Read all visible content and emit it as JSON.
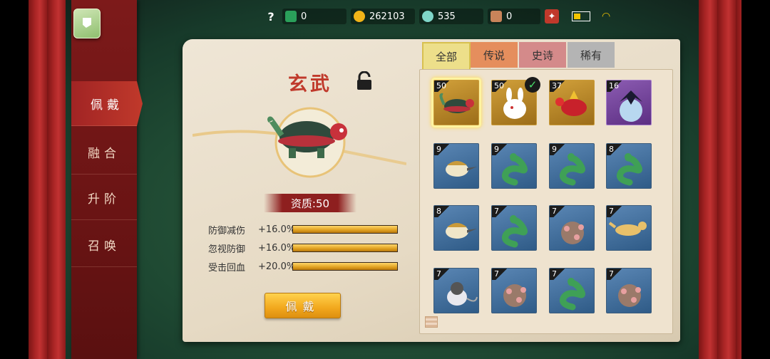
{
  "topbar": {
    "help": "?",
    "resources": [
      {
        "icon": "green-ticket-icon",
        "value": "0",
        "color": "#2aa05a"
      },
      {
        "icon": "gold-ingot-icon",
        "value": "262103",
        "color": "#f2b418"
      },
      {
        "icon": "jade-icon",
        "value": "535",
        "color": "#7fd6c8"
      },
      {
        "icon": "gate-token-icon",
        "value": "0",
        "color": "#c8845a"
      }
    ]
  },
  "sidebar": {
    "items": [
      {
        "label": "佩戴",
        "active": true
      },
      {
        "label": "融合",
        "active": false
      },
      {
        "label": "升阶",
        "active": false
      },
      {
        "label": "召唤",
        "active": false
      }
    ]
  },
  "detail": {
    "name": "玄武",
    "quality": "资质:50",
    "stats": [
      {
        "label": "防御减伤",
        "value": "+16.0%",
        "fill": 1.0
      },
      {
        "label": "忽视防御",
        "value": "+16.0%",
        "fill": 1.0
      },
      {
        "label": "受击回血",
        "value": "+20.0%",
        "fill": 1.0
      }
    ],
    "equip_label": "佩戴"
  },
  "tabs": [
    "全部",
    "传说",
    "史诗",
    "稀有"
  ],
  "pets": [
    {
      "level": "50",
      "rarity": "gold",
      "pet": "turtle-icon",
      "selected": true
    },
    {
      "level": "50",
      "rarity": "gold",
      "pet": "rabbit-icon",
      "equipped": true
    },
    {
      "level": "37",
      "rarity": "gold",
      "pet": "red-bird-icon"
    },
    {
      "level": "16",
      "rarity": "purple",
      "pet": "black-crow-icon"
    },
    {
      "level": "9",
      "rarity": "blue",
      "pet": "duckbill-icon"
    },
    {
      "level": "9",
      "rarity": "blue",
      "pet": "green-snake-icon"
    },
    {
      "level": "9",
      "rarity": "blue",
      "pet": "green-snake-icon"
    },
    {
      "level": "8",
      "rarity": "blue",
      "pet": "green-snake-icon"
    },
    {
      "level": "8",
      "rarity": "blue",
      "pet": "duckbill-icon"
    },
    {
      "level": "7",
      "rarity": "blue",
      "pet": "green-snake-icon"
    },
    {
      "level": "7",
      "rarity": "blue",
      "pet": "spotted-sheep-icon"
    },
    {
      "level": "7",
      "rarity": "blue",
      "pet": "otter-icon"
    },
    {
      "level": "7",
      "rarity": "blue",
      "pet": "mouse-icon"
    },
    {
      "level": "7",
      "rarity": "blue",
      "pet": "spotted-sheep-icon"
    },
    {
      "level": "7",
      "rarity": "blue",
      "pet": "green-snake-icon"
    },
    {
      "level": "7",
      "rarity": "blue",
      "pet": "spotted-sheep-icon"
    }
  ]
}
